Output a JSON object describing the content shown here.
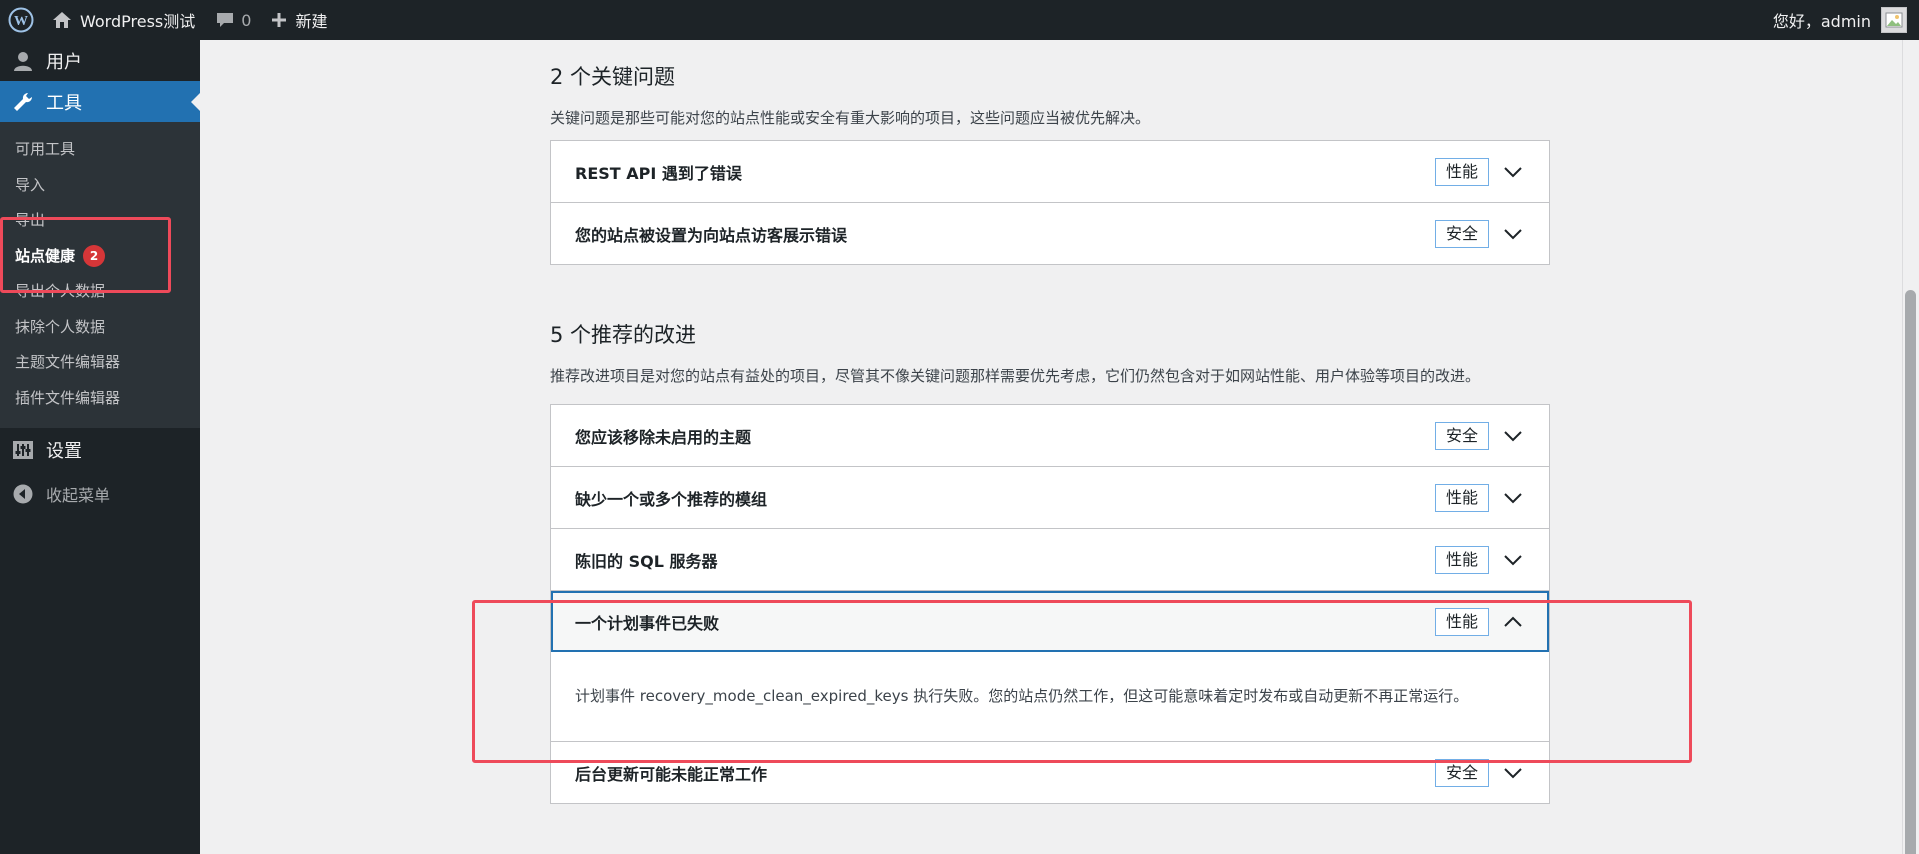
{
  "adminbar": {
    "site_name": "WordPress测试",
    "comments_count": "0",
    "new_label": "新建",
    "greeting": "您好，admin"
  },
  "sidebar": {
    "users_label": "用户",
    "tools_label": "工具",
    "tools_submenu": [
      {
        "label": "可用工具"
      },
      {
        "label": "导入"
      },
      {
        "label": "导出"
      },
      {
        "label": "站点健康",
        "badge": "2"
      },
      {
        "label": "导出个人数据"
      },
      {
        "label": "抹除个人数据"
      },
      {
        "label": "主题文件编辑器"
      },
      {
        "label": "插件文件编辑器"
      }
    ],
    "settings_label": "设置",
    "collapse_label": "收起菜单"
  },
  "critical": {
    "title": "2 个关键问题",
    "desc": "关键问题是那些可能对您的站点性能或安全有重大影响的项目，这些问题应当被优先解决。",
    "items": [
      {
        "title": "REST API 遇到了错误",
        "badge": "性能"
      },
      {
        "title": "您的站点被设置为向站点访客展示错误",
        "badge": "安全"
      }
    ]
  },
  "recommended": {
    "title": "5 个推荐的改进",
    "desc": "推荐改进项目是对您的站点有益处的项目，尽管其不像关键问题那样需要优先考虑，它们仍然包含对于如网站性能、用户体验等项目的改进。",
    "items": [
      {
        "title": "您应该移除未启用的主题",
        "badge": "安全"
      },
      {
        "title": "缺少一个或多个推荐的模组",
        "badge": "性能"
      },
      {
        "title": "陈旧的 SQL 服务器",
        "badge": "性能"
      },
      {
        "title": "一个计划事件已失败",
        "badge": "性能",
        "body": "计划事件 recovery_mode_clean_expired_keys 执行失败。您的站点仍然工作，但这可能意味着定时发布或自动更新不再正常运行。"
      },
      {
        "title": "后台更新可能未能正常工作",
        "badge": "安全"
      }
    ]
  },
  "colors": {
    "adminbar_bg": "#1d2327",
    "accent": "#2271b1",
    "badge_red": "#d63638",
    "annotation": "#ee4a5a"
  }
}
